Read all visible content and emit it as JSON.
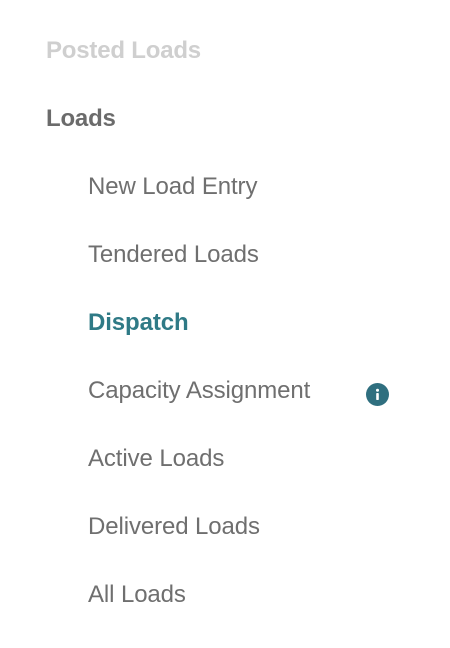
{
  "nav": {
    "posted_loads": "Posted Loads",
    "loads": "Loads",
    "items": [
      {
        "label": "New Load Entry"
      },
      {
        "label": "Tendered Loads"
      },
      {
        "label": "Dispatch",
        "active": true
      },
      {
        "label": "Capacity Assignment",
        "icon": "info-icon"
      },
      {
        "label": "Active Loads"
      },
      {
        "label": "Delivered Loads"
      },
      {
        "label": "All Loads"
      }
    ]
  },
  "colors": {
    "active": "#2f7a86",
    "text": "#6f6f6f",
    "muted": "#cfcfcf",
    "info_icon": "#2f6f7f"
  }
}
